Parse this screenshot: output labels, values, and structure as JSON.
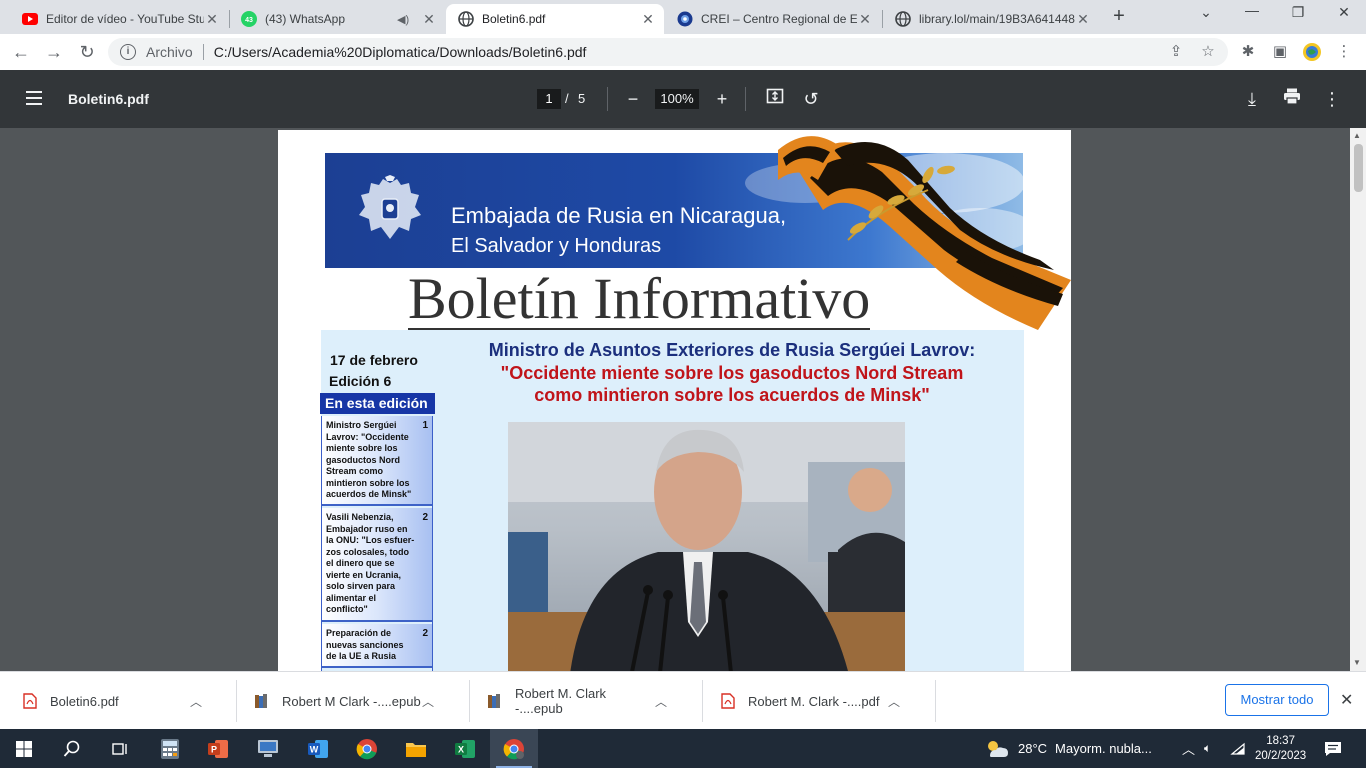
{
  "tabs": [
    {
      "title": "Editor de vídeo - YouTube Studio",
      "icon": "youtube-icon",
      "active": false
    },
    {
      "title": "(43) WhatsApp",
      "icon": "whatsapp-icon",
      "badge": "43",
      "active": false
    },
    {
      "title": "Boletin6.pdf",
      "icon": "globe-icon",
      "active": true
    },
    {
      "title": "CREI – Centro Regional de Estudios",
      "icon": "crei-icon",
      "active": false
    },
    {
      "title": "library.lol/main/19B3A641448",
      "icon": "globe-icon",
      "active": false
    }
  ],
  "toolbar": {
    "scheme_label": "Archivo",
    "url": "C:/Users/Academia%20Diplomatica/Downloads/Boletin6.pdf"
  },
  "pdf": {
    "filename": "Boletin6.pdf",
    "current_page": "1",
    "separator": "/",
    "total_pages": "5",
    "zoom": "100%"
  },
  "document": {
    "banner_line1": "Embajada de Rusia en Nicaragua,",
    "banner_line2": "El Salvador y Honduras",
    "title": "Boletín Informativo",
    "date": "17 de febrero",
    "edition": "Edición  6",
    "toc_header": "En esta edición",
    "toc": [
      {
        "text": "Ministro Sergúei Lavrov: \"Occidente miente sobre los gasoductos Nord Stream como mintieron sobre los acuerdos de Minsk\"",
        "page": "1"
      },
      {
        "text": "Vasili Nebenzia, Embajador ruso en la ONU: \"Los esfuer-zos colosales, todo el dinero que se vierte en Ucrania, solo sirven para alimentar el conflicto\"",
        "page": "2"
      },
      {
        "text": "Preparación de nuevas sanciones de la UE a Rusia",
        "page": "2"
      }
    ],
    "headline1": "Ministro de Asuntos Exteriores de Rusia Sergúei Lavrov:",
    "headline2_a": "\"Occidente miente sobre los gasoductos Nord Stream",
    "headline2_b": "como mintieron sobre los acuerdos de Minsk\""
  },
  "downloads": {
    "items": [
      {
        "name": "Boletin6.pdf",
        "icon": "pdf-file-icon"
      },
      {
        "name": "Robert M Clark -....epub",
        "icon": "epub-file-icon"
      },
      {
        "name": "Robert M. Clark -....epub",
        "icon": "epub-file-icon"
      },
      {
        "name": "Robert M. Clark -....pdf",
        "icon": "pdf-file-icon"
      }
    ],
    "show_all": "Mostrar todo"
  },
  "taskbar": {
    "weather_temp": "28°C",
    "weather_text": "Mayorm. nubla...",
    "time": "18:37",
    "date": "20/2/2023"
  },
  "colors": {
    "tabstrip": "#dee1e6",
    "pdf_toolbar": "#323639",
    "viewer_bg": "#525659",
    "accent": "#1a73e8",
    "headline_blue": "#1b2f7d",
    "headline_red": "#c0141a"
  }
}
